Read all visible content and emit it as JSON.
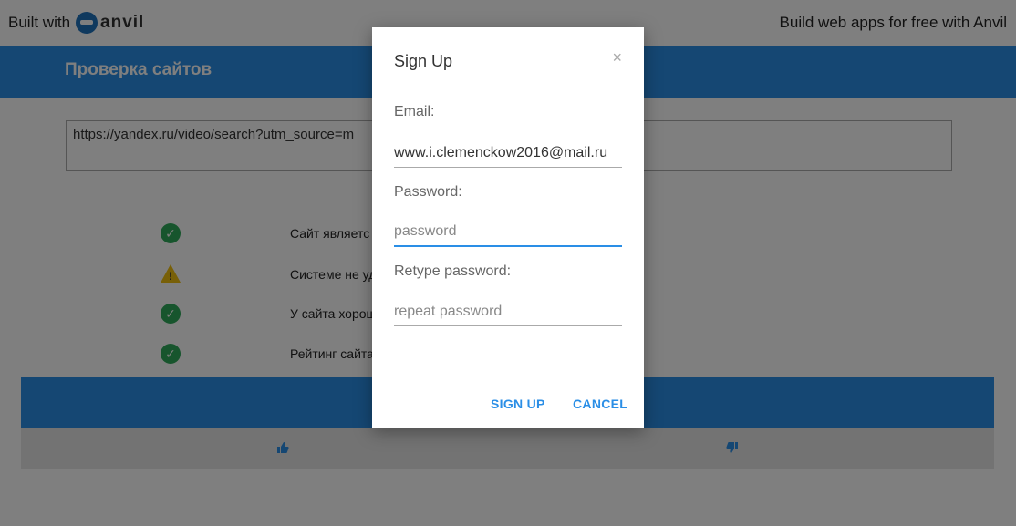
{
  "branding": {
    "built_with": "Built with",
    "anvil_word": "anvil",
    "promo": "Build web apps for free with Anvil"
  },
  "header": {
    "title": "Проверка сайтов"
  },
  "url_input": {
    "value": "https://yandex.ru/video/search?utm_source=m"
  },
  "checks": [
    {
      "icon": "check-circle",
      "text": "Сайт являетс"
    },
    {
      "icon": "warning-triangle",
      "text": "Системе не уд"
    },
    {
      "icon": "check-circle",
      "text": "У сайта хорош"
    },
    {
      "icon": "check-circle",
      "text": "Рейтинг сайта"
    }
  ],
  "vote": {
    "like_icon": "thumbs-up",
    "dislike_icon": "thumbs-down"
  },
  "modal": {
    "title": "Sign Up",
    "close_symbol": "×",
    "email_label": "Email:",
    "email_value": "www.i.clemenckow2016@mail.ru",
    "password_label": "Password:",
    "password_placeholder": "password",
    "retype_label": "Retype password:",
    "retype_placeholder": "repeat password",
    "signup_button": "SIGN UP",
    "cancel_button": "CANCEL"
  },
  "colors": {
    "accent": "#2a8ee6",
    "success": "#2eaa5a",
    "warning": "#f0c010"
  }
}
